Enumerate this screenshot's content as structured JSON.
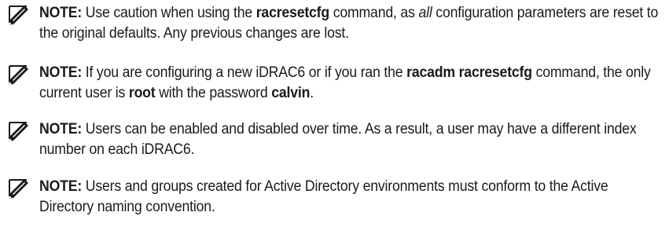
{
  "notes": [
    {
      "label": "NOTE:",
      "parts": {
        "t1": " Use caution when using the ",
        "b1": "racresetcfg",
        "t2": " command, as ",
        "i1": "all",
        "t3": " configuration parameters are reset to the original defaults. Any previous changes are lost."
      }
    },
    {
      "label": "NOTE:",
      "parts": {
        "t1": " If you are configuring a new iDRAC6 or if you ran the ",
        "b1": "racadm racresetcfg",
        "t2": " command, the only current user is ",
        "b2": "root",
        "t3": " with the password ",
        "b3": "calvin",
        "t4": "."
      }
    },
    {
      "label": "NOTE:",
      "parts": {
        "t1": " Users can be enabled and disabled over time. As a result, a user may have a different index number on each iDRAC6."
      }
    },
    {
      "label": "NOTE:",
      "parts": {
        "t1": " Users and groups created for Active Directory environments must conform to the Active Directory naming convention."
      }
    }
  ],
  "icons": {
    "note": "pencil-note-icon"
  }
}
